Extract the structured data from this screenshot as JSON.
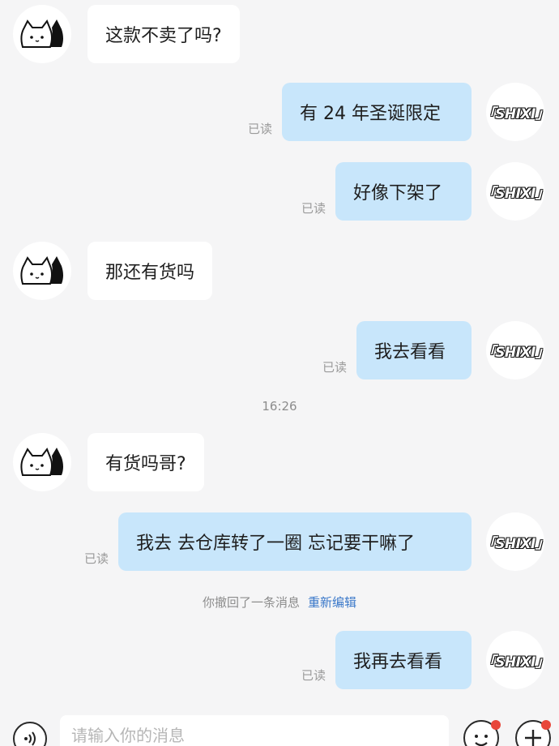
{
  "contact_avatar": {
    "icon": "cat-avatar-icon"
  },
  "self_avatar": {
    "text": "「SHIXI」"
  },
  "messages": [
    {
      "side": "in",
      "text": "这款不卖了吗?"
    },
    {
      "side": "out",
      "text": "有 24 年圣诞限定",
      "status": "已读"
    },
    {
      "side": "out",
      "text": "好像下架了",
      "status": "已读"
    },
    {
      "side": "in",
      "text": "那还有货吗"
    },
    {
      "side": "out",
      "text": "我去看看",
      "status": "已读"
    },
    {
      "side": "in",
      "text": "有货吗哥?"
    },
    {
      "side": "out",
      "text": "我去 去仓库转了一圈 忘记要干嘛了",
      "status": "已读"
    },
    {
      "side": "out",
      "text": "我再去看看",
      "status": "已读"
    }
  ],
  "timestamp": "16:26",
  "recall_notice": {
    "text": "你撤回了一条消息",
    "action": "重新编辑"
  },
  "input_bar": {
    "placeholder": "请输入你的消息",
    "voice_icon": "voice-icon",
    "emoji_icon": "emoji-icon",
    "plus_icon": "plus-icon",
    "badge_color": "#e8473a"
  },
  "colors": {
    "outgoing_bubble": "#c8e6fb",
    "incoming_bubble": "#ffffff",
    "background": "#f5f5f6",
    "link": "#3a78c9"
  }
}
